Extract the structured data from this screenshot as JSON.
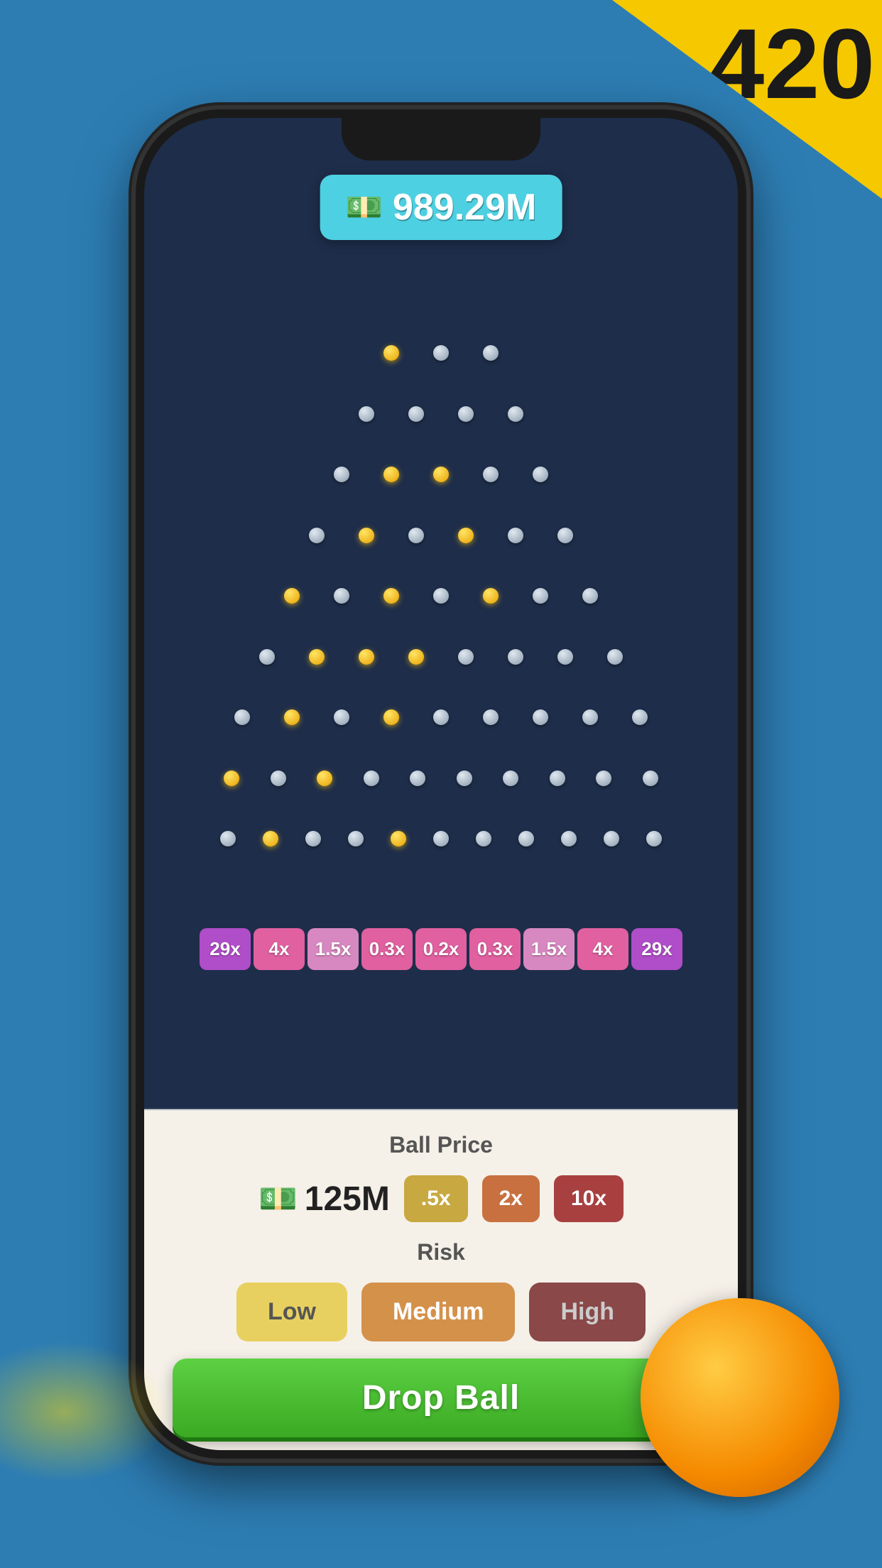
{
  "badge": {
    "number": "420"
  },
  "balance": {
    "icon": "💵",
    "amount": "989.29M"
  },
  "board": {
    "multipliers": [
      {
        "label": "29x",
        "style": "mult-purple"
      },
      {
        "label": "4x",
        "style": "mult-pink"
      },
      {
        "label": "1.5x",
        "style": "mult-light-pink"
      },
      {
        "label": "0.3x",
        "style": "mult-pink"
      },
      {
        "label": "0.2x",
        "style": "mult-pink"
      },
      {
        "label": "0.3x",
        "style": "mult-pink"
      },
      {
        "label": "1.5x",
        "style": "mult-light-pink"
      },
      {
        "label": "4x",
        "style": "mult-pink"
      },
      {
        "label": "29x",
        "style": "mult-purple"
      }
    ]
  },
  "controls": {
    "ball_price_label": "Ball Price",
    "ball_price_icon": "💵",
    "ball_price_amount": "125M",
    "multiplier_buttons": [
      {
        "label": ".5x",
        "style": "btn-half"
      },
      {
        "label": "2x",
        "style": "btn-2x"
      },
      {
        "label": "10x",
        "style": "btn-10x"
      }
    ],
    "risk_label": "Risk",
    "risk_buttons": [
      {
        "label": "Low",
        "style": "risk-low"
      },
      {
        "label": "Medium",
        "style": "risk-medium"
      },
      {
        "label": "High",
        "style": "risk-high"
      }
    ],
    "drop_button": "Drop Ball"
  }
}
